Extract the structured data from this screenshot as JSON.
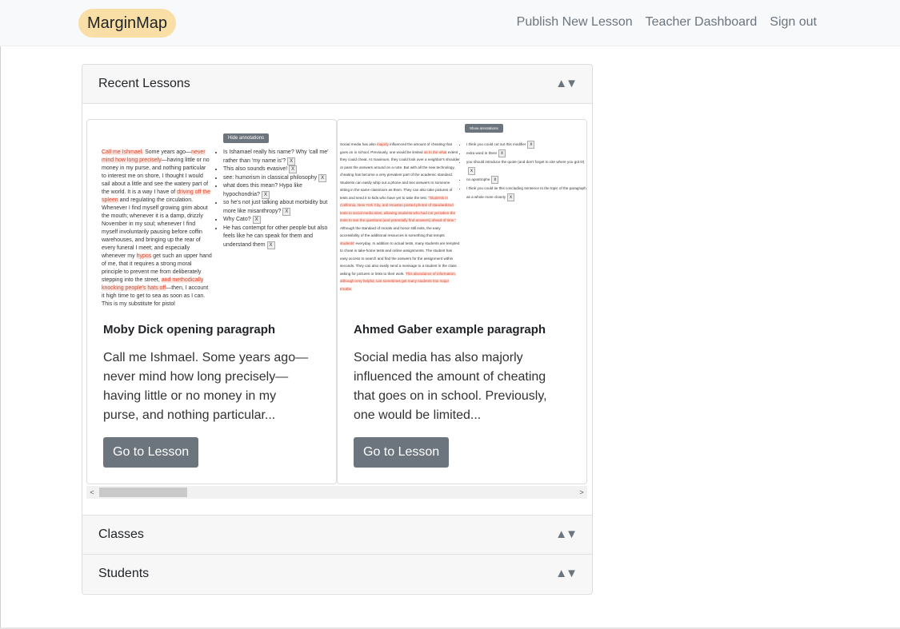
{
  "navbar": {
    "brand": "MarginMap",
    "links": [
      "Publish New Lesson",
      "Teacher Dashboard",
      "Sign out"
    ]
  },
  "sections": {
    "recent": "Recent Lessons",
    "classes": "Classes",
    "students": "Students",
    "toggle": "▲▼"
  },
  "lessons": [
    {
      "title": "Moby Dick opening paragraph",
      "excerpt": "Call me Ishmael. Some years ago—never mind how long precisely—having little or no money in my purse, and nothing particular...",
      "button": "Go to Lesson",
      "thumb_button": "Hide annotations",
      "thumb_text": [
        {
          "t": "Call me Ishmael.",
          "h": true
        },
        {
          "t": " Some years ago—",
          "h": false
        },
        {
          "t": "never mind how long precisely",
          "h": true
        },
        {
          "t": "—having little or no money in my purse, and nothing particular to interest me on shore, I thought I would sail about a little and see the watery part of the world. It is a way I have of ",
          "h": false
        },
        {
          "t": "driving off the spleen",
          "h": true
        },
        {
          "t": " and regulating the circulation. Whenever I find myself growing grim about the mouth; whenever it is a damp, drizzly November in my soul; whenever I find myself involuntarily pausing before coffin warehouses, and bringing up the rear of every funeral I meet; and especially whenever my ",
          "h": false
        },
        {
          "t": "hypos",
          "h": true
        },
        {
          "t": " get such an upper hand of me, that it requires a strong moral principle to prevent me from deliberately stepping into the street, ",
          "h": false
        },
        {
          "t": "and methodically knocking people's hats off",
          "h": true
        },
        {
          "t": "—then, I account it high time to get to sea as soon as I can. This is my substitute for pistol",
          "h": false
        }
      ],
      "annotations": [
        "Is Ishamael really his name? Why 'call me' rather than 'my name is'?",
        "This also sounds evasive!",
        "see: humorism in classical philosophy",
        "what does this mean? Hypo like hypochondria?",
        "so he's not just talking about morbidity but more like misanthropy?",
        "Why Cato?",
        "He has contempt for other people but also feels like he can speak for them and understand them"
      ],
      "close": "X"
    },
    {
      "title": "Ahmed Gaber example paragraph",
      "excerpt": "Social media has also majorly influenced the amount of cheating that goes on in school. Previously, one would be limited...",
      "button": "Go to Lesson",
      "thumb_button": "Show annotations",
      "thumb_text": [
        {
          "t": "Social media has also ",
          "h": false
        },
        {
          "t": "majorly",
          "h": true
        },
        {
          "t": " influenced the amount of cheating that goes on in school. Previously, one would be limited ",
          "h": false
        },
        {
          "t": "as to the what",
          "h": true
        },
        {
          "t": " extent they could cheat. At maximum, they could look over a neighbor's shoulder or pass the answers around on a note. But with all the new technology, cheating has become a very prevalent part of the academic standard. Students can easily whip out a phone and text answers to someone sitting in the same classroom as them. They can also take pictures of tests and send it to kids who have yet to take the test. ",
          "h": false
        },
        {
          "t": "\"Students in California, New York City, and Houston posted photos of standardized tests to social media sites, allowing students who had not yet taken the tests to see the questions (and potentially find answers) ahead of time.\"",
          "h": true
        },
        {
          "t": " Although the standard of morals and honor still exits, the easy accessibility of the additional resources is something that tempts ",
          "h": false
        },
        {
          "t": "students'",
          "h": true
        },
        {
          "t": " everyday. In addition to actual tests, many students are tempted to cheat in take-home tests and online assignments. The student has easy access to search and find the answers for the assignment within seconds. They can also easily send a message to a student in the class asking for pictures or links to their work. ",
          "h": false
        },
        {
          "t": "This abundance of information, although very helpful, can sometimes get many students into major trouble.",
          "h": true
        }
      ],
      "annotations": [
        "I think you could cut out this modifier",
        "extra word in there",
        "you should introduce the quote (and don't forget to cite where you got it!)",
        "no apostrophe",
        "I think you could tie this concluding sentence to the topic of the paragraph as a whole more closely"
      ],
      "close": "x"
    }
  ],
  "scroll": {
    "left": "<",
    "right": ">",
    "position_fraction": 0
  }
}
